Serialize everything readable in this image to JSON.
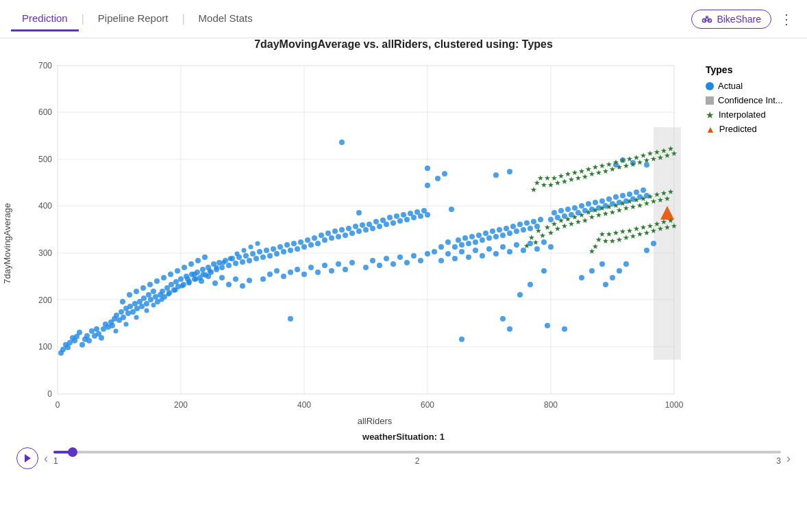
{
  "header": {
    "tabs": [
      {
        "id": "prediction",
        "label": "Prediction",
        "active": true
      },
      {
        "id": "pipeline-report",
        "label": "Pipeline Report",
        "active": false
      },
      {
        "id": "model-stats",
        "label": "Model Stats",
        "active": false
      }
    ],
    "app_button": "BikeShare",
    "more_icon": "⋮"
  },
  "chart": {
    "title": "7dayMovingAverage vs. allRiders, clustered using: Types",
    "x_axis_label": "allRiders",
    "y_axis_label": "7dayMovingAverage",
    "x_ticks": [
      "0",
      "200",
      "400",
      "600",
      "800",
      "1000"
    ],
    "y_ticks": [
      "0",
      "100",
      "200",
      "300",
      "400",
      "500",
      "600",
      "700"
    ],
    "legend": {
      "title": "Types",
      "items": [
        {
          "label": "Actual",
          "type": "dot"
        },
        {
          "label": "Confidence Int...",
          "type": "square"
        },
        {
          "label": "Interpolated",
          "type": "star"
        },
        {
          "label": "Predicted",
          "type": "triangle"
        }
      ]
    }
  },
  "slider": {
    "label": "weatherSituation: 1",
    "min": "1",
    "mid": "2",
    "max": "3",
    "value": 1
  }
}
